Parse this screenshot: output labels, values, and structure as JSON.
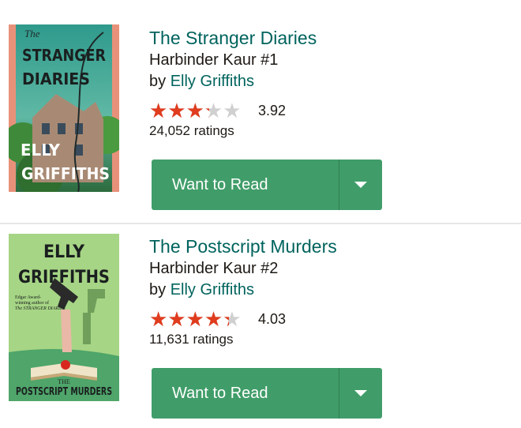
{
  "books": [
    {
      "cover_title_lines": [
        "The",
        "STRANGER",
        "DIARIES"
      ],
      "cover_author_lines": [
        "ELLY",
        "GRIFFITHS"
      ],
      "title": "The Stranger Diaries",
      "series": "Harbinder Kaur #1",
      "by_prefix": "by",
      "author": "Elly Griffiths",
      "rating": 3.92,
      "rating_text": "3.92",
      "ratings_count": "24,052 ratings",
      "button_label": "Want to Read"
    },
    {
      "cover_title_lines": [
        "THE",
        "POSTSCRIPT MURDERS"
      ],
      "cover_author_lines": [
        "ELLY",
        "GRIFFITHS"
      ],
      "cover_blurb_lines": [
        "Edgar Award-",
        "winning author of",
        "The STRANGER DIARIES"
      ],
      "title": "The Postscript Murders",
      "series": "Harbinder Kaur #2",
      "by_prefix": "by",
      "author": "Elly Griffiths",
      "rating": 4.03,
      "rating_text": "4.03",
      "ratings_count": "11,631 ratings",
      "button_label": "Want to Read"
    }
  ],
  "colors": {
    "link": "#00635d",
    "text": "#1e1915",
    "button": "#409d69",
    "star_filled": "#e03c1e",
    "star_empty": "#d0d0d0"
  },
  "icons": {
    "star": "star-icon",
    "dropdown": "chevron-down-icon"
  }
}
